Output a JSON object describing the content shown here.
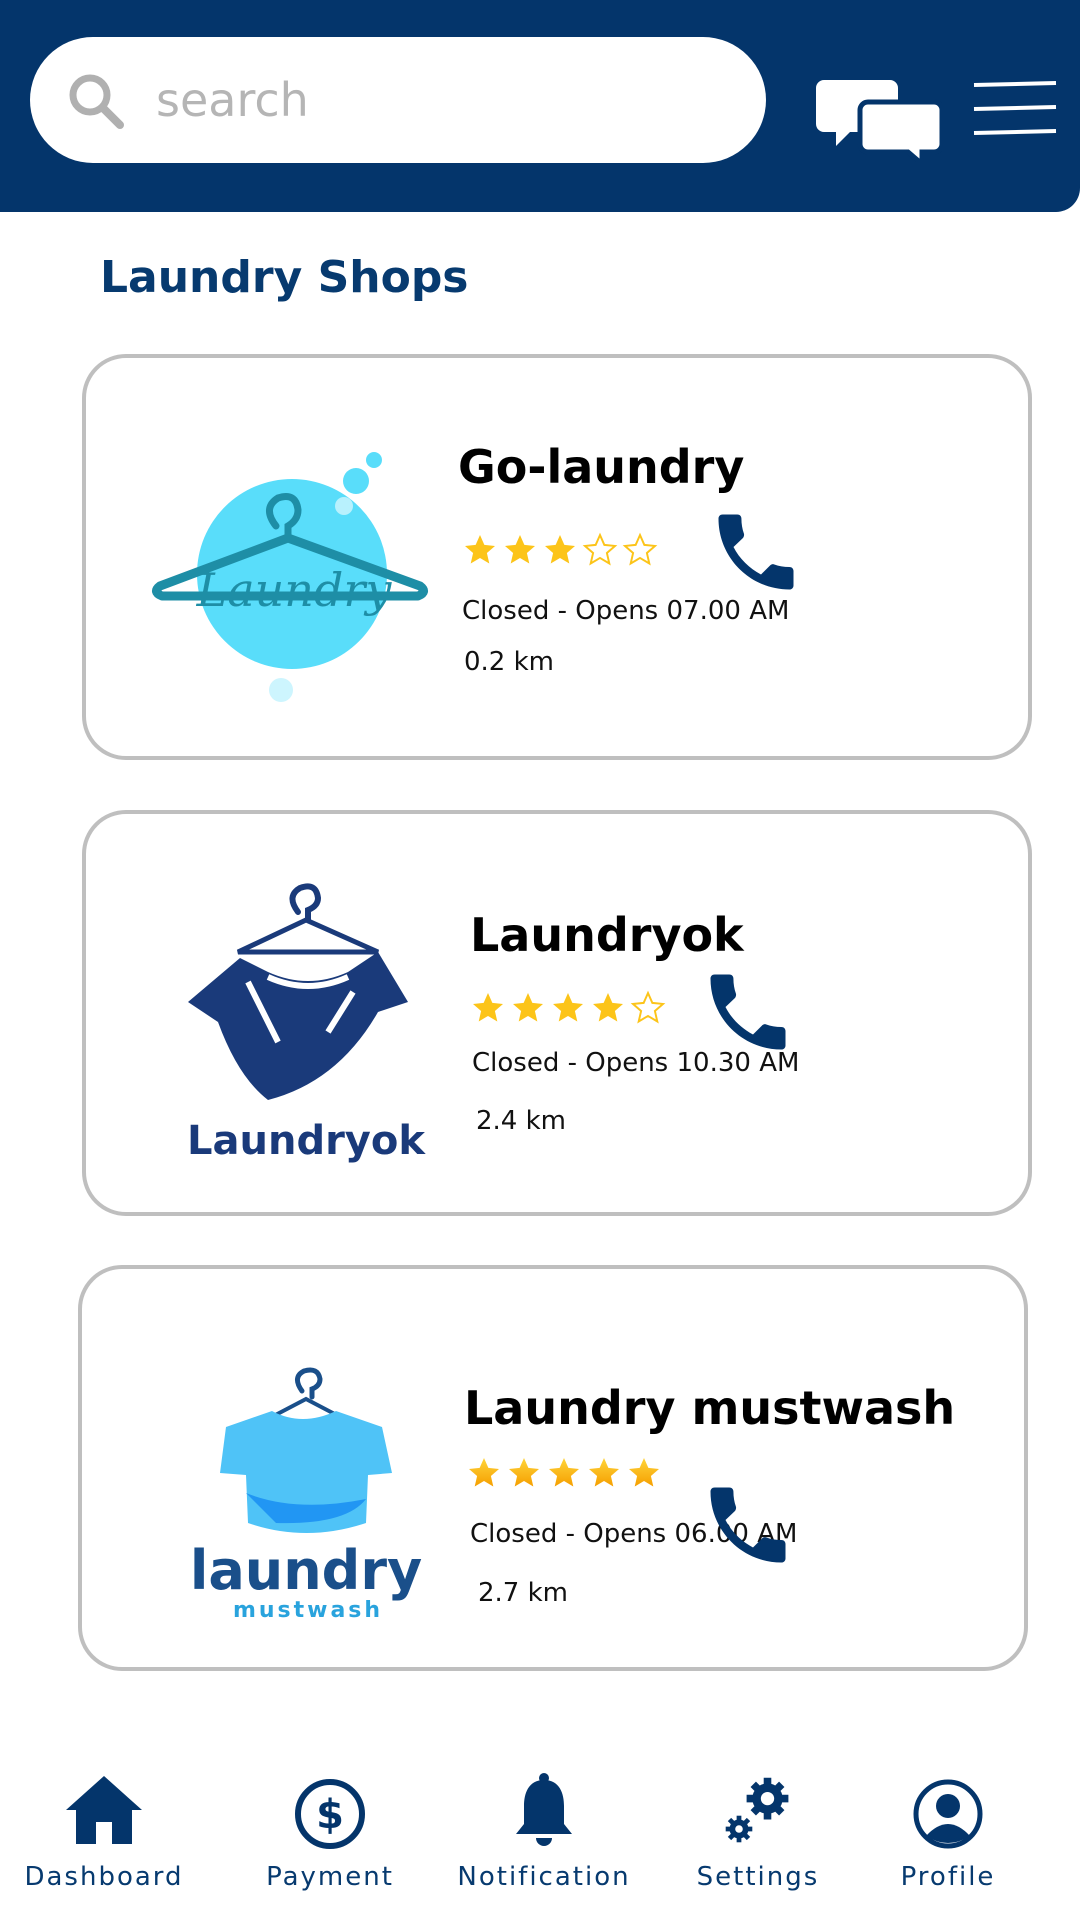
{
  "header": {
    "search": {
      "placeholder": "search",
      "icon": "search-icon"
    },
    "chat_icon": "chat-icon",
    "menu_icon": "hamburger-menu-icon"
  },
  "section_title": "Laundry Shops",
  "shops": [
    {
      "name": "Go-laundry",
      "logo_text": "Laundry",
      "rating": 3,
      "rating_max": 5,
      "status": "Closed - Opens 07.00 AM",
      "distance": "0.2 km"
    },
    {
      "name": "Laundryok",
      "logo_text": "Laundryok",
      "rating": 4,
      "rating_max": 5,
      "status": "Closed - Opens 10.30 AM",
      "distance": "2.4 km"
    },
    {
      "name": "Laundry mustwash",
      "logo_text": "laundry",
      "logo_subtext": "mustwash",
      "rating": 5,
      "rating_max": 5,
      "status": "Closed - Opens 06.00 AM",
      "distance": "2.7 km"
    }
  ],
  "nav": [
    {
      "label": "Dashboard",
      "icon": "home-icon"
    },
    {
      "label": "Payment",
      "icon": "dollar-icon"
    },
    {
      "label": "Notification",
      "icon": "bell-icon"
    },
    {
      "label": "Settings",
      "icon": "gear-icon"
    },
    {
      "label": "Profile",
      "icon": "user-icon"
    }
  ],
  "colors": {
    "primary": "#04356b",
    "star": "#fcc419",
    "card_border": "#bfbfbf"
  }
}
